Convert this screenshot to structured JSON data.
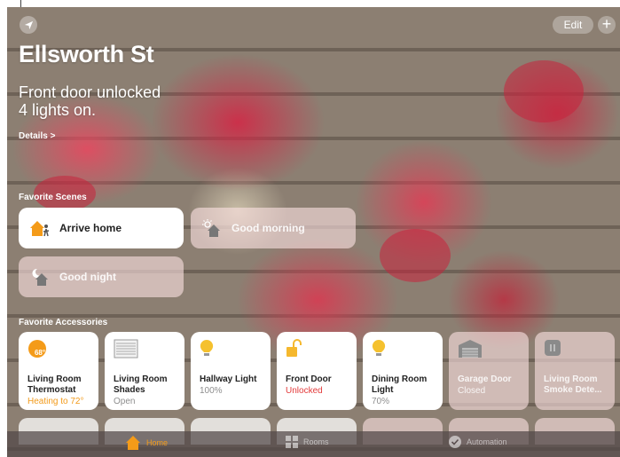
{
  "header": {
    "edit_label": "Edit",
    "add_label": "+",
    "home_name": "Ellsworth St",
    "status_line1": "Front door unlocked",
    "status_line2": "4 lights on.",
    "details_link": "Details >"
  },
  "scenes": {
    "section_label": "Favorite Scenes",
    "items": [
      {
        "label": "Arrive home",
        "state": "on",
        "icon": "arrive-home-icon"
      },
      {
        "label": "Good morning",
        "state": "off",
        "icon": "good-morning-icon"
      },
      {
        "label": "Good night",
        "state": "off",
        "icon": "good-night-icon"
      }
    ]
  },
  "accessories": {
    "section_label": "Favorite Accessories",
    "items": [
      {
        "name": "Living Room Thermostat",
        "status": "Heating to 72°",
        "state": "on",
        "icon": "thermostat-icon",
        "badge": "68°"
      },
      {
        "name": "Living Room Shades",
        "status": "Open",
        "state": "on",
        "icon": "shades-icon"
      },
      {
        "name": "Hallway Light",
        "status": "100%",
        "state": "on",
        "icon": "lightbulb-icon"
      },
      {
        "name": "Front Door",
        "status": "Unlocked",
        "state": "on",
        "icon": "lock-icon"
      },
      {
        "name": "Dining Room Light",
        "status": "70%",
        "state": "on",
        "icon": "lightbulb-icon"
      },
      {
        "name": "Garage Door",
        "status": "Closed",
        "state": "off",
        "icon": "garage-icon"
      },
      {
        "name": "Living Room Smoke Dete...",
        "status": "",
        "state": "off",
        "icon": "smoke-detector-icon"
      }
    ]
  },
  "tabbar": {
    "tabs": [
      {
        "label": "Home",
        "active": true,
        "icon": "home-icon"
      },
      {
        "label": "Rooms",
        "active": false,
        "icon": "rooms-icon"
      },
      {
        "label": "Automation",
        "active": false,
        "icon": "automation-icon"
      }
    ]
  },
  "colors": {
    "accent": "#f49b19",
    "unlocked": "#e33b3b",
    "heating": "#f29a1a"
  }
}
